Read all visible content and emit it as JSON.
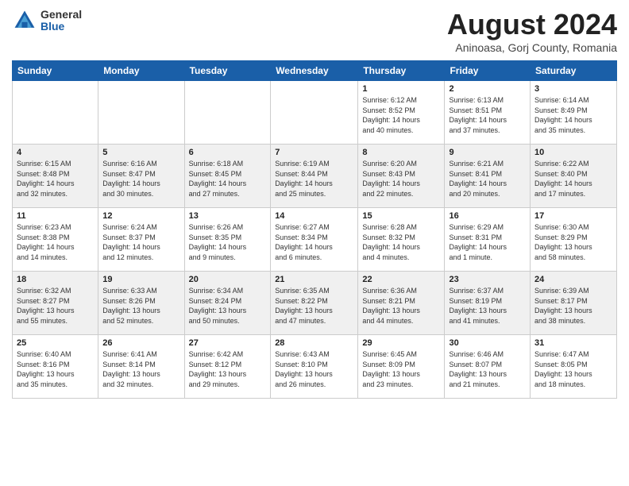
{
  "header": {
    "logo_general": "General",
    "logo_blue": "Blue",
    "title": "August 2024",
    "location": "Aninoasa, Gorj County, Romania"
  },
  "weekdays": [
    "Sunday",
    "Monday",
    "Tuesday",
    "Wednesday",
    "Thursday",
    "Friday",
    "Saturday"
  ],
  "weeks": [
    [
      {
        "day": "",
        "info": ""
      },
      {
        "day": "",
        "info": ""
      },
      {
        "day": "",
        "info": ""
      },
      {
        "day": "",
        "info": ""
      },
      {
        "day": "1",
        "info": "Sunrise: 6:12 AM\nSunset: 8:52 PM\nDaylight: 14 hours\nand 40 minutes."
      },
      {
        "day": "2",
        "info": "Sunrise: 6:13 AM\nSunset: 8:51 PM\nDaylight: 14 hours\nand 37 minutes."
      },
      {
        "day": "3",
        "info": "Sunrise: 6:14 AM\nSunset: 8:49 PM\nDaylight: 14 hours\nand 35 minutes."
      }
    ],
    [
      {
        "day": "4",
        "info": "Sunrise: 6:15 AM\nSunset: 8:48 PM\nDaylight: 14 hours\nand 32 minutes."
      },
      {
        "day": "5",
        "info": "Sunrise: 6:16 AM\nSunset: 8:47 PM\nDaylight: 14 hours\nand 30 minutes."
      },
      {
        "day": "6",
        "info": "Sunrise: 6:18 AM\nSunset: 8:45 PM\nDaylight: 14 hours\nand 27 minutes."
      },
      {
        "day": "7",
        "info": "Sunrise: 6:19 AM\nSunset: 8:44 PM\nDaylight: 14 hours\nand 25 minutes."
      },
      {
        "day": "8",
        "info": "Sunrise: 6:20 AM\nSunset: 8:43 PM\nDaylight: 14 hours\nand 22 minutes."
      },
      {
        "day": "9",
        "info": "Sunrise: 6:21 AM\nSunset: 8:41 PM\nDaylight: 14 hours\nand 20 minutes."
      },
      {
        "day": "10",
        "info": "Sunrise: 6:22 AM\nSunset: 8:40 PM\nDaylight: 14 hours\nand 17 minutes."
      }
    ],
    [
      {
        "day": "11",
        "info": "Sunrise: 6:23 AM\nSunset: 8:38 PM\nDaylight: 14 hours\nand 14 minutes."
      },
      {
        "day": "12",
        "info": "Sunrise: 6:24 AM\nSunset: 8:37 PM\nDaylight: 14 hours\nand 12 minutes."
      },
      {
        "day": "13",
        "info": "Sunrise: 6:26 AM\nSunset: 8:35 PM\nDaylight: 14 hours\nand 9 minutes."
      },
      {
        "day": "14",
        "info": "Sunrise: 6:27 AM\nSunset: 8:34 PM\nDaylight: 14 hours\nand 6 minutes."
      },
      {
        "day": "15",
        "info": "Sunrise: 6:28 AM\nSunset: 8:32 PM\nDaylight: 14 hours\nand 4 minutes."
      },
      {
        "day": "16",
        "info": "Sunrise: 6:29 AM\nSunset: 8:31 PM\nDaylight: 14 hours\nand 1 minute."
      },
      {
        "day": "17",
        "info": "Sunrise: 6:30 AM\nSunset: 8:29 PM\nDaylight: 13 hours\nand 58 minutes."
      }
    ],
    [
      {
        "day": "18",
        "info": "Sunrise: 6:32 AM\nSunset: 8:27 PM\nDaylight: 13 hours\nand 55 minutes."
      },
      {
        "day": "19",
        "info": "Sunrise: 6:33 AM\nSunset: 8:26 PM\nDaylight: 13 hours\nand 52 minutes."
      },
      {
        "day": "20",
        "info": "Sunrise: 6:34 AM\nSunset: 8:24 PM\nDaylight: 13 hours\nand 50 minutes."
      },
      {
        "day": "21",
        "info": "Sunrise: 6:35 AM\nSunset: 8:22 PM\nDaylight: 13 hours\nand 47 minutes."
      },
      {
        "day": "22",
        "info": "Sunrise: 6:36 AM\nSunset: 8:21 PM\nDaylight: 13 hours\nand 44 minutes."
      },
      {
        "day": "23",
        "info": "Sunrise: 6:37 AM\nSunset: 8:19 PM\nDaylight: 13 hours\nand 41 minutes."
      },
      {
        "day": "24",
        "info": "Sunrise: 6:39 AM\nSunset: 8:17 PM\nDaylight: 13 hours\nand 38 minutes."
      }
    ],
    [
      {
        "day": "25",
        "info": "Sunrise: 6:40 AM\nSunset: 8:16 PM\nDaylight: 13 hours\nand 35 minutes."
      },
      {
        "day": "26",
        "info": "Sunrise: 6:41 AM\nSunset: 8:14 PM\nDaylight: 13 hours\nand 32 minutes."
      },
      {
        "day": "27",
        "info": "Sunrise: 6:42 AM\nSunset: 8:12 PM\nDaylight: 13 hours\nand 29 minutes."
      },
      {
        "day": "28",
        "info": "Sunrise: 6:43 AM\nSunset: 8:10 PM\nDaylight: 13 hours\nand 26 minutes."
      },
      {
        "day": "29",
        "info": "Sunrise: 6:45 AM\nSunset: 8:09 PM\nDaylight: 13 hours\nand 23 minutes."
      },
      {
        "day": "30",
        "info": "Sunrise: 6:46 AM\nSunset: 8:07 PM\nDaylight: 13 hours\nand 21 minutes."
      },
      {
        "day": "31",
        "info": "Sunrise: 6:47 AM\nSunset: 8:05 PM\nDaylight: 13 hours\nand 18 minutes."
      }
    ]
  ]
}
